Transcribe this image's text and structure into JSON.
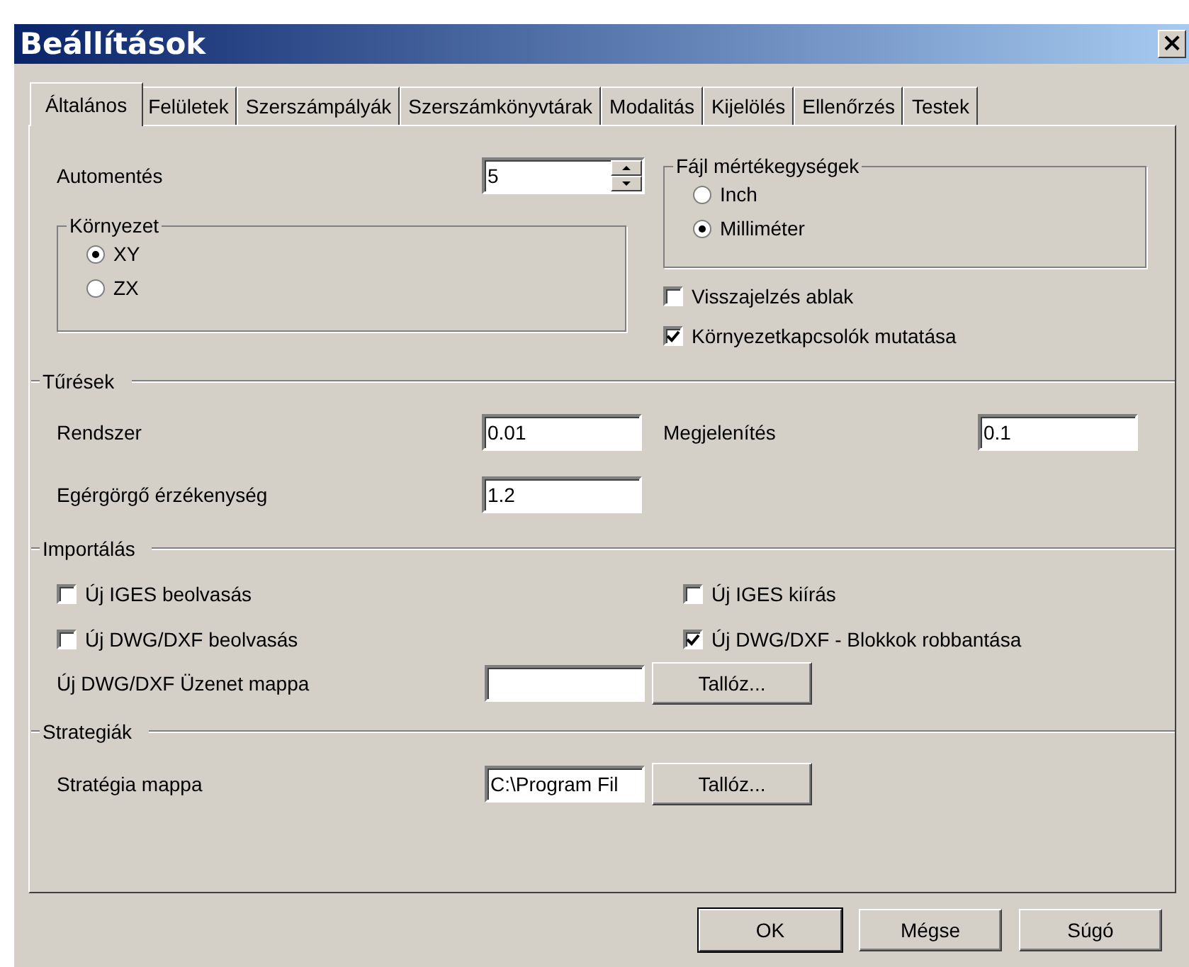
{
  "window": {
    "title": "Beállítások",
    "close": "×"
  },
  "tabs": [
    {
      "label": "Általános",
      "selected": true
    },
    {
      "label": "Felületek",
      "selected": false
    },
    {
      "label": "Szerszámpályák",
      "selected": false
    },
    {
      "label": "Szerszámkönyvtárak",
      "selected": false
    },
    {
      "label": "Modalitás",
      "selected": false
    },
    {
      "label": "Kijelölés",
      "selected": false
    },
    {
      "label": "Ellenőrzés",
      "selected": false
    },
    {
      "label": "Testek",
      "selected": false
    }
  ],
  "autosave": {
    "label": "Automentés",
    "value": "5"
  },
  "environment": {
    "title": "Környezet",
    "options": [
      {
        "label": "XY",
        "selected": true
      },
      {
        "label": "ZX",
        "selected": false
      }
    ]
  },
  "file_units": {
    "title": "Fájl mértékegységek",
    "options": [
      {
        "label": "Inch",
        "selected": false
      },
      {
        "label": "Milliméter",
        "selected": true
      }
    ]
  },
  "options": [
    {
      "label": "Visszajelzés ablak",
      "checked": false
    },
    {
      "label": "Környezetkapcsolók mutatása",
      "checked": true
    }
  ],
  "tolerances": {
    "title": "Tűrések",
    "system": {
      "label": "Rendszer",
      "value": "0.01"
    },
    "display": {
      "label": "Megjelenítés",
      "value": "0.1"
    },
    "wheel": {
      "label": "Egérgörgő érzékenység",
      "value": "1.2"
    }
  },
  "import": {
    "title": "Importálás",
    "checkboxes": [
      {
        "label": "Új IGES beolvasás",
        "checked": false
      },
      {
        "label": "Új IGES kiírás",
        "checked": false
      },
      {
        "label": "Új DWG/DXF beolvasás",
        "checked": false
      },
      {
        "label": "Új DWG/DXF - Blokkok robbantása",
        "checked": true
      }
    ],
    "message_folder": {
      "label": "Új DWG/DXF Üzenet mappa",
      "button": "Tallóz..."
    }
  },
  "strategies": {
    "title": "Strategiák",
    "folder": {
      "label": "Stratégia mappa",
      "value": "C:\\Program Fil",
      "button": "Tallóz..."
    }
  },
  "buttons": [
    {
      "label": "OK",
      "default": true
    },
    {
      "label": "Mégse",
      "default": false
    },
    {
      "label": "Súgó",
      "default": false
    }
  ]
}
